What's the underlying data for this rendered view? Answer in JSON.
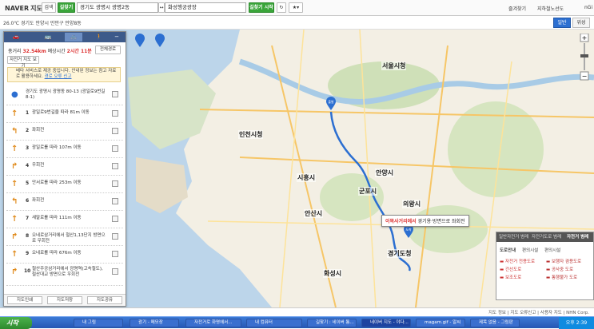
{
  "topbar": {
    "logo": "NAVER",
    "logo_suffix": "지도",
    "search_tab": "검색",
    "route_tab": "길찾기",
    "origin": "경기도 광명시 광명2동",
    "destination": "화성행궁광장",
    "route_button": "길찾기 시작",
    "right_links": [
      "즐겨찾기",
      "지하철노선도",
      "nGi"
    ]
  },
  "inforow": {
    "weather": "26.0℃  경기도 안양시 만안구 안양8동",
    "layers": [
      "일반",
      "위성"
    ]
  },
  "panel": {
    "modes": [
      "자동차",
      "대중교통",
      "자전거",
      "도보"
    ],
    "total_label": "총거리",
    "total_value": "32.54km",
    "time_label": "예상시간",
    "time_value": "2시간 11분",
    "all_route_btn": "전체경로",
    "profile_btn": "자전거 지도 보기",
    "notice": "베타 서비스로 제공 중입니다. 안내된 정보는 참고 자료로 활용하세요.",
    "notice_link": "경로 오류 신고",
    "start_text": "경기도 광명시 광명동 80-13 (광일로9번길 8-1)",
    "steps": [
      {
        "num": "1",
        "text": "광일로9번길을 따라 81m 이동"
      },
      {
        "num": "2",
        "text": "좌회전"
      },
      {
        "num": "3",
        "text": "광일로를 따라 107m 이동"
      },
      {
        "num": "4",
        "text": "우회전"
      },
      {
        "num": "5",
        "text": "안서로를 따라 253m 이동"
      },
      {
        "num": "6",
        "text": "좌회전"
      },
      {
        "num": "7",
        "text": "새말로를 따라 111m 이동"
      },
      {
        "num": "8",
        "text": "오네로삼거리에서 철산1,13단지 방면으로 우회전"
      },
      {
        "num": "9",
        "text": "오네로를 따라 676m 이동"
      },
      {
        "num": "10",
        "text": "철산주공삼거리에서 광명역(고속철도), 철산대교 방면으로 우회전"
      }
    ],
    "footer": [
      "지도인쇄",
      "지도저장",
      "지도공유"
    ]
  },
  "map": {
    "labels": [
      {
        "text": "서울시청"
      },
      {
        "text": "인천시청"
      },
      {
        "text": "시흥시"
      },
      {
        "text": "안산시"
      },
      {
        "text": "군포시"
      },
      {
        "text": "안양시"
      },
      {
        "text": "의왕시"
      },
      {
        "text": "경기도청"
      },
      {
        "text": "화성시"
      }
    ],
    "callout_place": "이목사거리에서",
    "callout_rest": " 경기용·방면으로 좌회전",
    "pin_start": "출발",
    "pin_end": "도착"
  },
  "legend": {
    "tabs": [
      "일반자전거 범례",
      "자전거도로 범례",
      "자전거 범례"
    ],
    "subtabs": [
      "도로안내",
      "편의시설",
      "편의시설"
    ],
    "items": [
      "자전거 전용도로",
      "보행자 겸용도로",
      "간선도로",
      "공사중 도로",
      "보조도로",
      "통행불가 도로"
    ]
  },
  "status": "지도 정보 | 지도 오류신고 | 사용자 지도 | NHN Corp.",
  "taskbar": {
    "start": "시작",
    "tasks": [
      "내 그림",
      "광기 - 메모장",
      "자전거로 화명에서...",
      "내 컴퓨터",
      "길찾기 : 네이버 통...",
      "네이버 지도 - 야다...",
      "magam.gif - 알씨",
      "제목 없음 - 그림판"
    ],
    "clock": "오후 2:39"
  }
}
